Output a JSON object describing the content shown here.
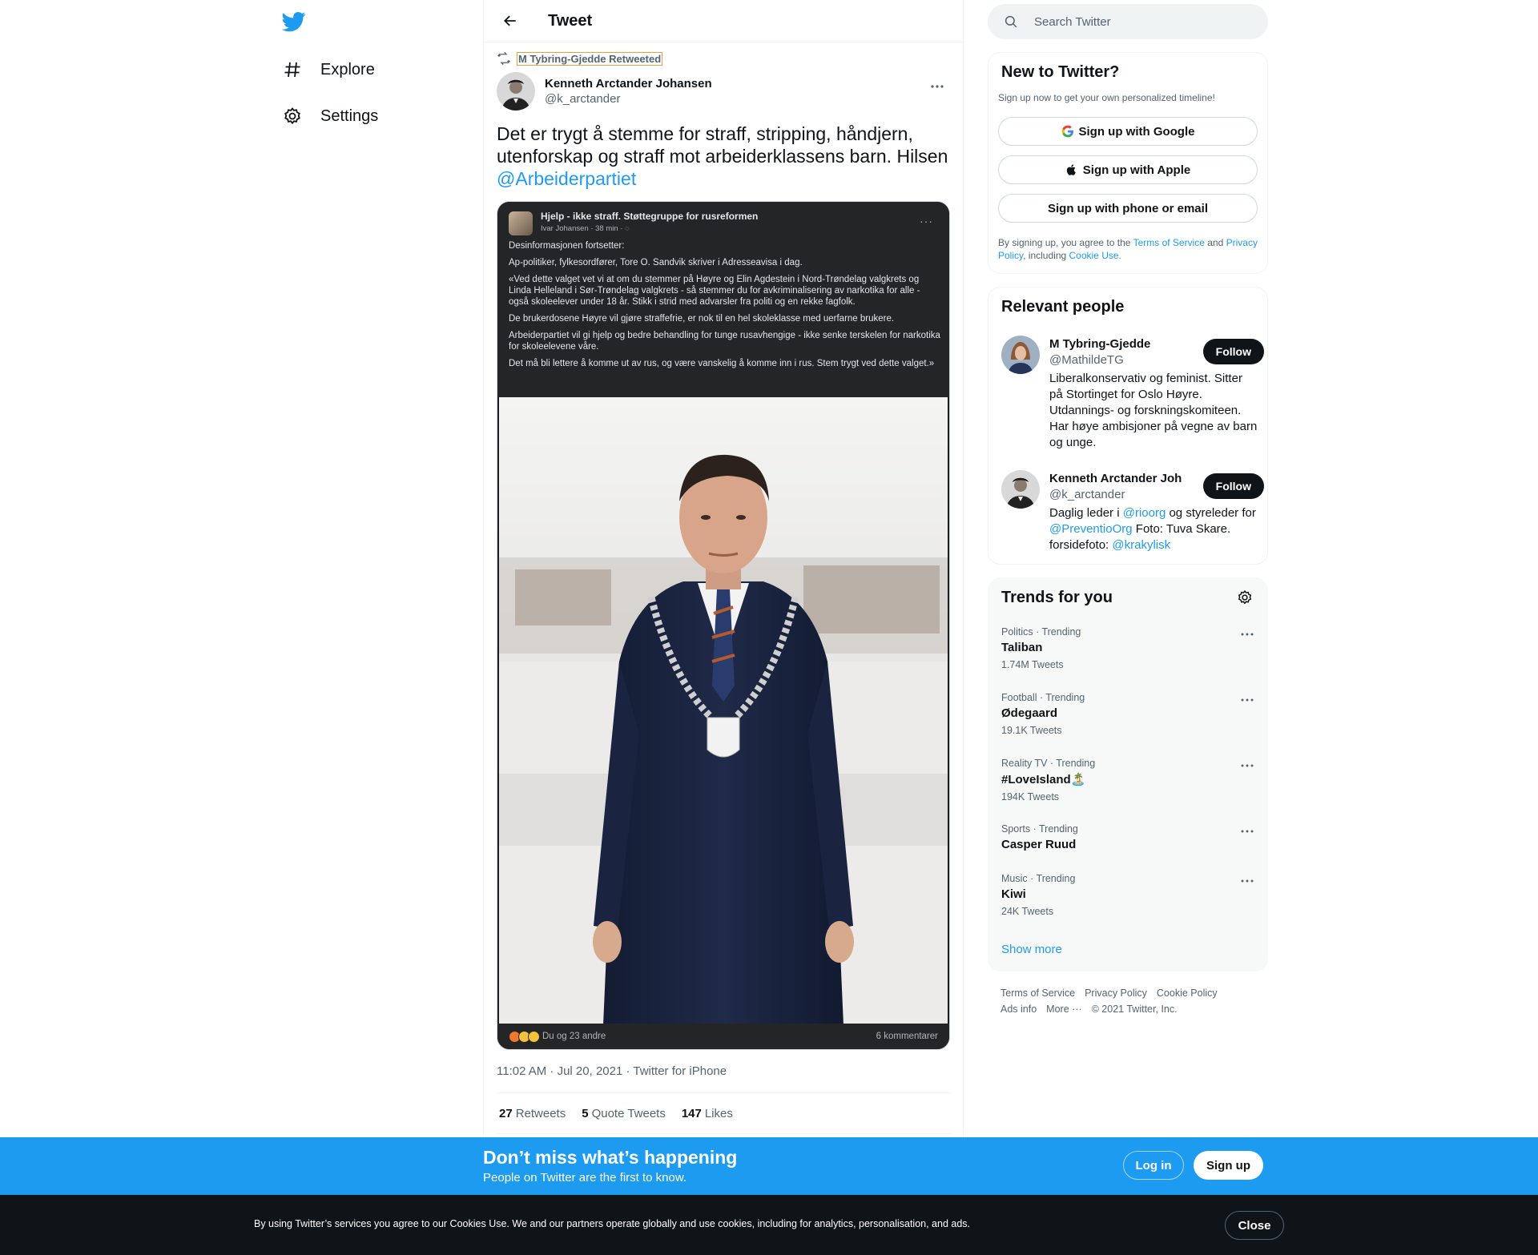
{
  "nav": {
    "logo_icon": "twitter-bird-icon",
    "items": [
      {
        "label": "Explore",
        "icon": "hashtag-icon"
      },
      {
        "label": "Settings",
        "icon": "gear-icon"
      }
    ]
  },
  "header": {
    "title": "Tweet",
    "back_icon": "arrow-left-icon"
  },
  "tweet": {
    "retweeted_by": "M Tybring-Gjedde Retweeted",
    "author_name": "Kenneth Arctander Johansen",
    "author_handle": "@k_arctander",
    "text": "Det er trygt å stemme for straff, stripping, håndjern, utenforskap og straff mot arbeiderklassens barn. Hilsen ",
    "mention": "@Arbeiderpartiet",
    "timestamp": "11:02 AM · Jul 20, 2021 · Twitter for iPhone",
    "stats": {
      "retweets_count": "27",
      "retweets_label": "Retweets",
      "quotes_count": "5",
      "quotes_label": "Quote Tweets",
      "likes_count": "147",
      "likes_label": "Likes"
    },
    "media": {
      "group_name": "Hjelp - ikke straff. Støttegruppe for rusreformen",
      "post_meta": "Ivar Johansen · 38 min · ",
      "paragraphs": [
        "Desinformasjonen fortsetter:",
        "Ap-politiker, fylkesordfører, Tore O. Sandvik skriver i Adresseavisa i dag.",
        "«Ved dette valget vet vi at om du stemmer på Høyre og Elin Agdestein i Nord-Trøndelag valgkrets og Linda Helleland i Sør-Trøndelag valgkrets - så stemmer du for avkriminalisering av narkotika for alle - også skoleelever under 18 år. Stikk i strid med advarsler fra politi og en rekke fagfolk.",
        "De brukerdosene Høyre vil gjøre straffefrie, er nok til en hel skoleklasse med uerfarne brukere.",
        "Arbeiderpartiet vil gi hjelp og bedre behandling for tunge rusavhengige - ikke senke terskelen for narkotika for skoleelevene våre.",
        "Det må bli lettere å komme ut av rus, og være vanskelig å komme inn i rus. Stem trygt ved dette valget.»"
      ],
      "reactions_label": "Du og 23 andre",
      "comments_label": "6 kommentarer"
    }
  },
  "search": {
    "placeholder": "Search Twitter"
  },
  "new_to_twitter": {
    "title": "New to Twitter?",
    "subtitle": "Sign up now to get your own personalized timeline!",
    "google_label": "Sign up with Google",
    "apple_label": "Sign up with Apple",
    "phone_label": "Sign up with phone or email",
    "legal_prefix": "By signing up, you agree to the ",
    "terms_link": "Terms of Service",
    "and": " and ",
    "privacy_link": "Privacy Policy",
    "including": ", including ",
    "cookie_link": "Cookie Use."
  },
  "relevant_people": {
    "title": "Relevant people",
    "people": [
      {
        "name": "M Tybring-Gjedde",
        "handle": "@MathildeTG",
        "bio": "Liberalkonservativ og feminist. Sitter på Stortinget for Oslo Høyre. Utdannings- og forskningskomiteen. Har høye ambisjoner på vegne av barn og unge.",
        "follow_label": "Follow"
      },
      {
        "name": "Kenneth Arctander Johansen",
        "handle": "@k_arctander",
        "bio_prefix": "Daglig leder i ",
        "bio_link1": "@rioorg",
        "bio_mid": " og styreleder for ",
        "bio_link2": "@PreventioOrg",
        "bio_mid2": " Foto: Tuva Skare. forsidefoto: ",
        "bio_link3": "@krakylisk",
        "follow_label": "Follow"
      }
    ]
  },
  "trends": {
    "title": "Trends for you",
    "items": [
      {
        "meta": "Politics · Trending",
        "name": "Taliban",
        "count": "1.74M Tweets"
      },
      {
        "meta": "Football · Trending",
        "name": "Ødegaard",
        "count": "19.1K Tweets"
      },
      {
        "meta": "Reality TV · Trending",
        "name": "#LoveIsland🏝️",
        "count": "194K Tweets"
      },
      {
        "meta": "Sports · Trending",
        "name": "Casper Ruud",
        "count": ""
      },
      {
        "meta": "Music · Trending",
        "name": "Kiwi",
        "count": "24K Tweets"
      }
    ],
    "show_more": "Show more"
  },
  "footer": {
    "terms": "Terms of Service",
    "privacy": "Privacy Policy",
    "cookie": "Cookie Policy",
    "ads": "Ads info",
    "more": "More ···",
    "copyright": "© 2021 Twitter, Inc."
  },
  "banner": {
    "title": "Don’t miss what’s happening",
    "subtitle": "People on Twitter are the first to know.",
    "login": "Log in",
    "signup": "Sign up"
  },
  "cookie_bar": {
    "text": "By using Twitter’s services you agree to our Cookies Use. We and our partners operate globally and use cookies, including for analytics, personalisation, and ads.",
    "close": "Close"
  },
  "colors": {
    "accent": "#1d9bf0",
    "text": "#0f1419",
    "muted": "#536471",
    "banner": "#1d9bf0",
    "cookie_bg": "#0f1419"
  }
}
